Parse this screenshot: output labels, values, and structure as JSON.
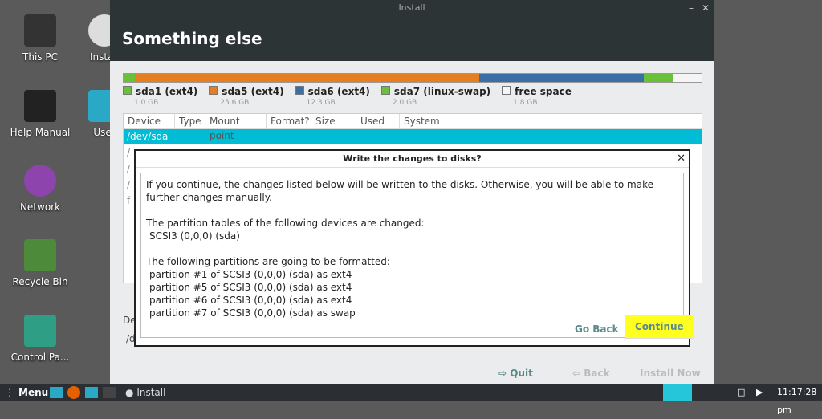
{
  "desktop": {
    "icons": [
      {
        "label": "This PC"
      },
      {
        "label": "Install"
      },
      {
        "label": "Help Manual"
      },
      {
        "label": "User"
      },
      {
        "label": "Network"
      },
      {
        "label": "Recycle Bin"
      },
      {
        "label": "Control Pa..."
      }
    ]
  },
  "window": {
    "title": "Install",
    "header": "Something else",
    "partitions": [
      {
        "name": "sda1 (ext4)",
        "size": "1.0 GB",
        "color": "#6ac139"
      },
      {
        "name": "sda5 (ext4)",
        "size": "25.6 GB",
        "color": "#e67e22"
      },
      {
        "name": "sda6 (ext4)",
        "size": "12.3 GB",
        "color": "#3b6ea5"
      },
      {
        "name": "sda7 (linux-swap)",
        "size": "2.0 GB",
        "color": "#6ac139"
      },
      {
        "name": "free space",
        "size": "1.8 GB",
        "color": "#f5f5f5"
      }
    ],
    "table": {
      "headers": [
        "Device",
        "Type",
        "Mount point",
        "Format?",
        "Size",
        "Used",
        "System"
      ],
      "selected_row": "/dev/sda",
      "faded": [
        "/",
        "/",
        "/",
        "f"
      ]
    },
    "bottom": {
      "quit": "Quit",
      "back": "Back",
      "install_now": "Install Now",
      "label_de": "De",
      "dev": "/d"
    }
  },
  "dialog": {
    "title": "Write the changes to disks?",
    "intro": "If you continue, the changes listed below will be written to the disks. Otherwise, you will be able to make further changes manually.",
    "tables_heading": "The partition tables of the following devices are changed:",
    "tables": [
      "SCSI3 (0,0,0) (sda)"
    ],
    "format_heading": "The following partitions are going to be formatted:",
    "format_items": [
      "partition #1 of SCSI3 (0,0,0) (sda) as ext4",
      "partition #5 of SCSI3 (0,0,0) (sda) as ext4",
      "partition #6 of SCSI3 (0,0,0) (sda) as ext4",
      "partition #7 of SCSI3 (0,0,0) (sda) as swap"
    ],
    "go_back": "Go Back",
    "continue": "Continue"
  },
  "taskbar": {
    "menu": "Menu",
    "task": "Install",
    "clock": "11:17:28 pm"
  }
}
